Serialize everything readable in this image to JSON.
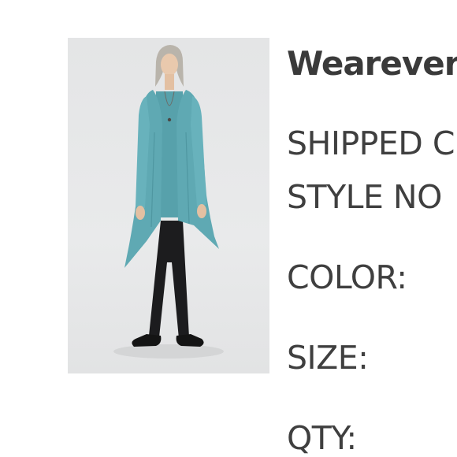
{
  "product": {
    "title": "Wearever",
    "image_alt": "woman wearing a teal drape-front cardigan over a teal top with black slim pants and black flats"
  },
  "details": {
    "shipped_label": "SHIPPED C",
    "style_label": "STYLE NO",
    "color_label": "COLOR:",
    "size_label": "SIZE:",
    "qty_label": "QTY:"
  },
  "colors": {
    "garment": "#5fa9b3",
    "pants": "#1c1c1e",
    "photo_background": "#e6e7e8",
    "text": "#3f3f3f"
  }
}
